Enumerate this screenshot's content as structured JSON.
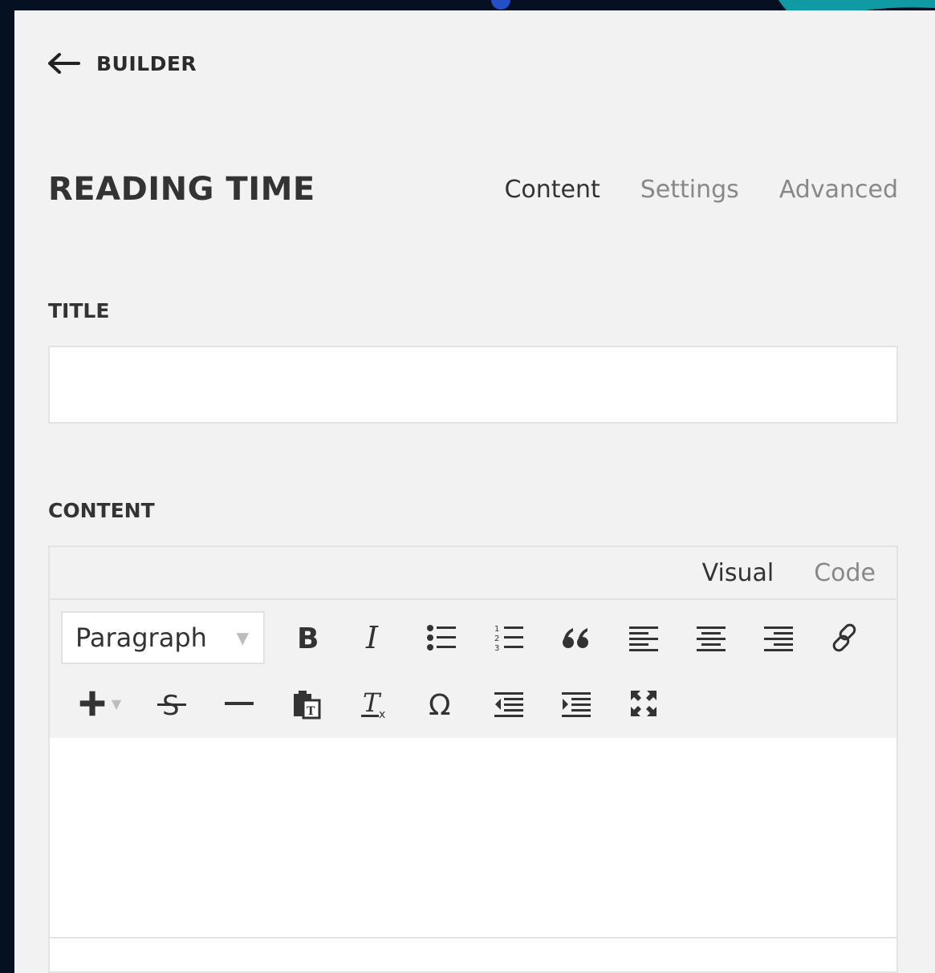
{
  "header": {
    "back_label": "BUILDER"
  },
  "module": {
    "title": "READING TIME",
    "tabs": [
      {
        "label": "Content",
        "active": true
      },
      {
        "label": "Settings",
        "active": false
      },
      {
        "label": "Advanced",
        "active": false
      }
    ]
  },
  "fields": {
    "title": {
      "label": "TITLE",
      "value": "",
      "placeholder": ""
    },
    "content": {
      "label": "CONTENT"
    }
  },
  "editor": {
    "modes": [
      {
        "label": "Visual",
        "active": true
      },
      {
        "label": "Code",
        "active": false
      }
    ],
    "format_select": "Paragraph",
    "toolbar_row1": [
      "bold-icon",
      "italic-icon",
      "bullet-list-icon",
      "numbered-list-icon",
      "blockquote-icon",
      "align-left-icon",
      "align-center-icon",
      "align-right-icon",
      "link-icon"
    ],
    "toolbar_row2": [
      "add-icon",
      "strikethrough-icon",
      "horizontal-rule-icon",
      "paste-text-icon",
      "clear-formatting-icon",
      "special-character-icon",
      "outdent-icon",
      "indent-icon",
      "fullscreen-icon"
    ]
  },
  "colors": {
    "background": "#061023",
    "panel": "#f2f2f2",
    "accent_arrow": "#0f9aa4",
    "text_dark": "#333333",
    "text_muted": "#888888"
  }
}
